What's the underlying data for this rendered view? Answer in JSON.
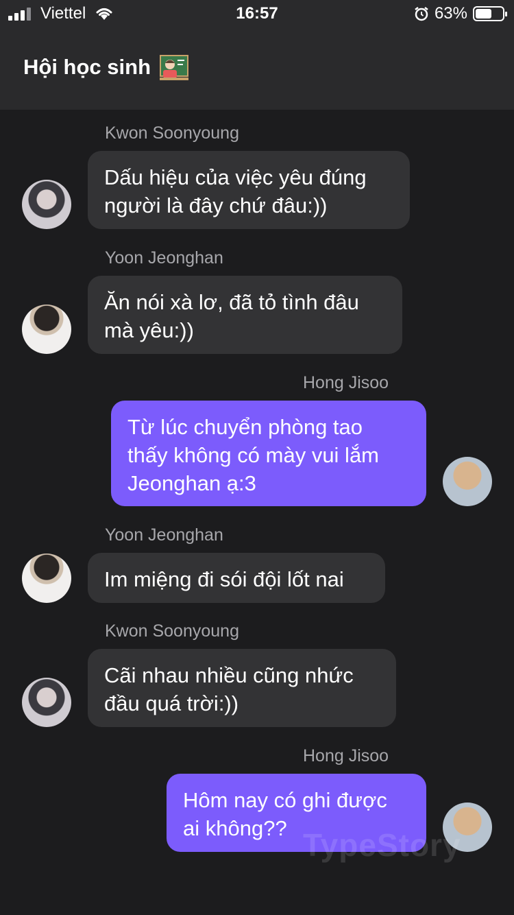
{
  "status_bar": {
    "carrier": "Viettel",
    "time": "16:57",
    "battery": "63%",
    "battery_level": 0.63
  },
  "header": {
    "title": "Hội học sinh"
  },
  "messages": [
    {
      "sender": "Kwon Soonyoung",
      "direction": "incoming",
      "text": [
        "Dấu hiệu của việc yêu đúng",
        "người là đây chứ đâu:))"
      ]
    },
    {
      "sender": "Yoon Jeonghan",
      "direction": "incoming",
      "text": [
        "Ăn nói xà lơ, đã tỏ tình đâu",
        "mà yêu:))"
      ]
    },
    {
      "sender": "Hong Jisoo",
      "direction": "outgoing",
      "text": [
        "Từ lúc chuyển phòng tao",
        "thấy không có mày vui lắm",
        "Jeonghan ạ:3"
      ]
    },
    {
      "sender": "Yoon Jeonghan",
      "direction": "incoming",
      "text": [
        "Im miệng đi sói đội lốt nai"
      ]
    },
    {
      "sender": "Kwon Soonyoung",
      "direction": "incoming",
      "text": [
        "Cãi nhau nhiều cũng nhức",
        "đầu quá trời:))"
      ]
    },
    {
      "sender": "Hong Jisoo",
      "direction": "outgoing",
      "text": [
        "Hôm nay có ghi được",
        "ai không??"
      ]
    }
  ],
  "watermark": "TypeStory",
  "colors": {
    "outgoing_bubble": "#7c5cfc",
    "incoming_bubble": "#333335",
    "background": "#1c1c1e"
  }
}
